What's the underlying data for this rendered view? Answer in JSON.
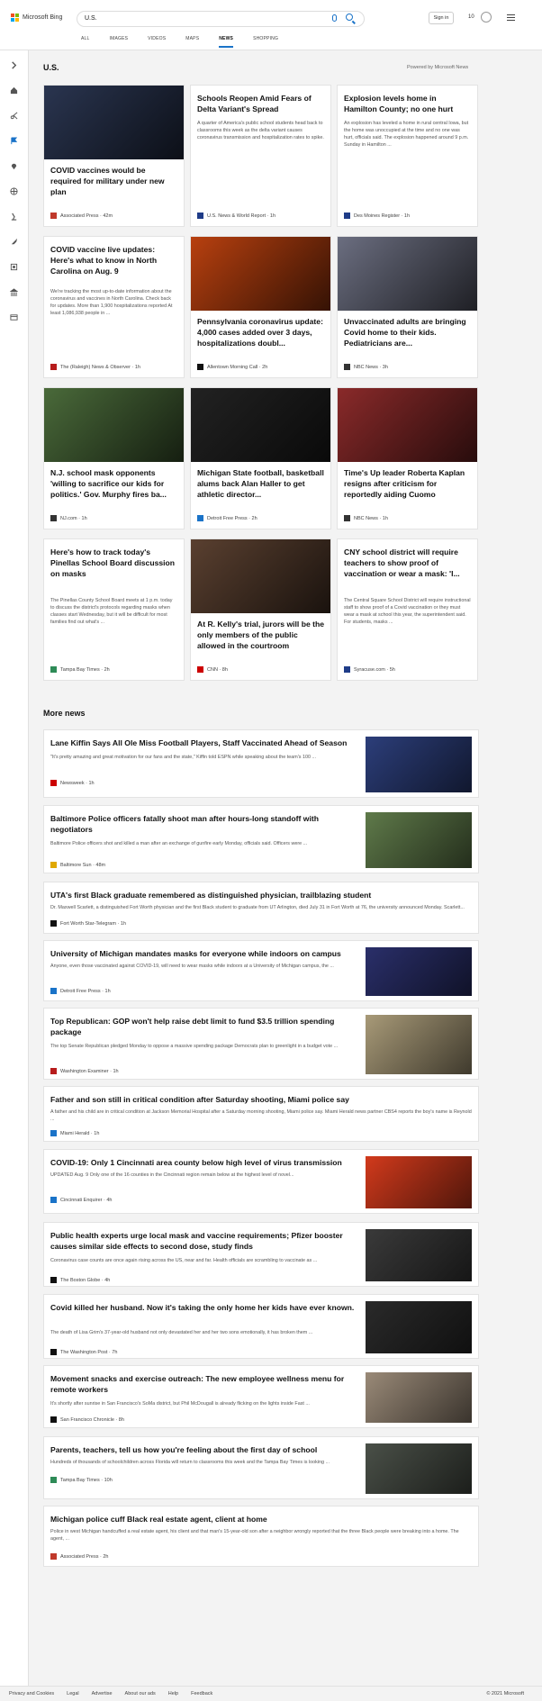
{
  "header": {
    "brand": "Microsoft Bing",
    "query": "U.S.",
    "signin": "Sign in",
    "rewards": "10"
  },
  "tabs": [
    "ALL",
    "IMAGES",
    "VIDEOS",
    "MAPS",
    "NEWS",
    "SHOPPING"
  ],
  "section": {
    "title": "U.S.",
    "powered": "Powered by Microsoft News"
  },
  "cards": [
    {
      "title": "COVID vaccines would be required for military under new plan",
      "summary": "",
      "source": "Associated Press · 42m",
      "img": "#2a3550",
      "icon": "#c0392b"
    },
    {
      "title": "Schools Reopen Amid Fears of Delta Variant's Spread",
      "summary": "A quarter of America's public school students head back to classrooms this week as the delta variant causes coronavirus transmission and hospitalization rates to spike.",
      "source": "U.S. News & World Report · 1h",
      "img": "",
      "icon": "#1f3c88"
    },
    {
      "title": "Explosion levels home in Hamilton County; no one hurt",
      "summary": "An explosion has leveled a home in rural central Iowa, but the home was unoccupied at the time and no one was hurt, officials said. The explosion happened around 9 p.m. Sunday in Hamilton ...",
      "source": "Des Moines Register · 1h",
      "img": "",
      "icon": "#1f3c88"
    },
    {
      "title": "COVID vaccine live updates: Here's what to know in North Carolina on Aug. 9",
      "summary": "We're tracking the most up-to-date information about the coronavirus and vaccines in North Carolina. Check back for updates. More than 1,900 hospitalizations reported At least 1,086,938 people in ...",
      "source": "The (Raleigh) News & Observer · 1h",
      "img": "",
      "icon": "#b71c1c"
    },
    {
      "title": "Pennsylvania coronavirus update: 4,000 cases added over 3 days, hospitalizations doubl...",
      "summary": "",
      "source": "Allentown Morning Call · 2h",
      "img": "#b8400f",
      "icon": "#111"
    },
    {
      "title": "Unvaccinated adults are bringing Covid home to their kids. Pediatricians are...",
      "summary": "",
      "source": "NBC News · 3h",
      "img": "#6b6e80",
      "icon": "#333"
    },
    {
      "title": "N.J. school mask opponents 'willing to sacrifice our kids for politics.' Gov. Murphy fires ba...",
      "summary": "",
      "source": "NJ.com · 1h",
      "img": "#4a6a3a",
      "icon": "#333"
    },
    {
      "title": "Michigan State football, basketball alums back Alan Haller to get athletic director...",
      "summary": "",
      "source": "Detroit Free Press · 2h",
      "img": "#222",
      "icon": "#1a73c8"
    },
    {
      "title": "Time's Up leader Roberta Kaplan resigns after criticism for reportedly aiding Cuomo",
      "summary": "",
      "source": "NBC News · 1h",
      "img": "#8a2a2a",
      "icon": "#333"
    },
    {
      "title": "Here's how to track today's Pinellas School Board discussion on masks",
      "summary": "The Pinellas County School Board meets at 1 p.m. today to discuss the district's protocols regarding masks when classes start Wednesday, but it will be difficult for most families find out what's ...",
      "source": "Tampa Bay Times · 2h",
      "img": "",
      "icon": "#2e8b57"
    },
    {
      "title": "At R. Kelly's trial, jurors will be the only members of the public allowed in the courtroom",
      "summary": "",
      "source": "CNN · 8h",
      "img": "#5a4030",
      "icon": "#cc0000"
    },
    {
      "title": "CNY school district will require teachers to show proof of vaccination or wear a mask: 'I...",
      "summary": "The Central Square School District will require instructional staff to show proof of a Covid vaccination or they must wear a mask at school this year, the superintendent said. For students, masks ...",
      "source": "Syracuse.com · 5h",
      "img": "",
      "icon": "#1f3c88"
    }
  ],
  "more_title": "More news",
  "rows": [
    {
      "title": "Lane Kiffin Says All Ole Miss Football Players, Staff Vaccinated Ahead of Season",
      "summary": "\"It's pretty amazing and great motivation for our fans and the state,\" Kiffin told ESPN while speaking about the team's 100 ...",
      "source": "Newsweek · 1h",
      "img": "#2c3e7a",
      "icon": "#cc0000"
    },
    {
      "title": "Baltimore Police officers fatally shoot man after hours-long standoff with negotiators",
      "summary": "Baltimore Police officers shot and killed a man after an exchange of gunfire early Monday, officials said. Officers were ...",
      "source": "Baltimore Sun · 48m",
      "img": "#5f7a4a",
      "icon": "#e0a800"
    },
    {
      "title": "UTA's first Black graduate remembered as distinguished physician, trailblazing student",
      "summary": "Dr. Maxwell Scarlett, a distinguished Fort Worth physician and the first Black student to graduate from UT Arlington, died July 31 in Fort Worth at 76, the university announced Monday. Scarlett...",
      "source": "Fort Worth Star-Telegram · 1h",
      "img": "",
      "icon": "#111"
    },
    {
      "title": "University of Michigan mandates masks for everyone while indoors on campus",
      "summary": "Anyone, even those vaccinated against COVID-19, will need to wear masks while indoors at a University of Michigan campus, the ...",
      "source": "Detroit Free Press · 1h",
      "img": "#2a2f6a",
      "icon": "#1a73c8"
    },
    {
      "title": "Top Republican: GOP won't help raise debt limit to fund $3.5 trillion spending package",
      "summary": "The top Senate Republican pledged Monday to oppose a massive spending package Democrats plan to greenlight in a budget vote ...",
      "source": "Washington Examiner · 1h",
      "img": "#a89a78",
      "icon": "#b71c1c"
    },
    {
      "title": "Father and son still in critical condition after Saturday shooting, Miami police say",
      "summary": "A father and his child are in critical condition at Jackson Memorial Hospital after a Saturday morning shooting, Miami police say. Miami Herald news partner CBS4 reports the boy's name is Reynold ...",
      "source": "Miami Herald · 1h",
      "img": "",
      "icon": "#1a73c8"
    },
    {
      "title": "COVID-19: Only 1 Cincinnati area county below high level of virus transmission",
      "summary": "UPDATED Aug. 9 Only one of the 16 counties in the Cincinnati region remain below at the highest level of novel...",
      "source": "Cincinnati Enquirer · 4h",
      "img": "#d23a1c",
      "icon": "#1a73c8"
    },
    {
      "title": "Public health experts urge local mask and vaccine requirements; Pfizer booster causes similar side effects to second dose, study finds",
      "summary": "Coronavirus case counts are once again rising across the US, near and far. Health officials are scrambling to vaccinate as ...",
      "source": "The Boston Globe · 4h",
      "img": "#3a3a3a",
      "icon": "#111"
    },
    {
      "title": "Covid killed her husband. Now it's taking the only home her kids have ever known.",
      "summary": "The death of Lisa Grim's 37-year-old husband not only devastated her and her two sons emotionally, it has broken them ...",
      "source": "The Washington Post · 7h",
      "img": "#2a2a2a",
      "icon": "#111"
    },
    {
      "title": "Movement snacks and exercise outreach: The new employee wellness menu for remote workers",
      "summary": "It's shortly after sunrise in San Francisco's SoMa district, but Phil McDougall is already flicking on the lights inside Fast ...",
      "source": "San Francisco Chronicle · 8h",
      "img": "#9a8a78",
      "icon": "#111"
    },
    {
      "title": "Parents, teachers, tell us how you're feeling about the first day of school",
      "summary": "Hundreds of thousands of schoolchildren across Florida will return to classrooms this week and the Tampa Bay Times is looking ...",
      "source": "Tampa Bay Times · 10h",
      "img": "#4a5048",
      "icon": "#2e8b57"
    },
    {
      "title": "Michigan police cuff Black real estate agent, client at home",
      "summary": "Police in west Michigan handcuffed a real estate agent, his client and that man's 15-year-old son after a neighbor wrongly reported that the three Black people were breaking into a home. The agent, ...",
      "source": "Associated Press · 2h",
      "img": "",
      "icon": "#c0392b"
    }
  ],
  "footer": {
    "links": [
      "Privacy and Cookies",
      "Legal",
      "Advertise",
      "About our ads",
      "Help",
      "Feedback"
    ],
    "copyright": "© 2021 Microsoft"
  }
}
